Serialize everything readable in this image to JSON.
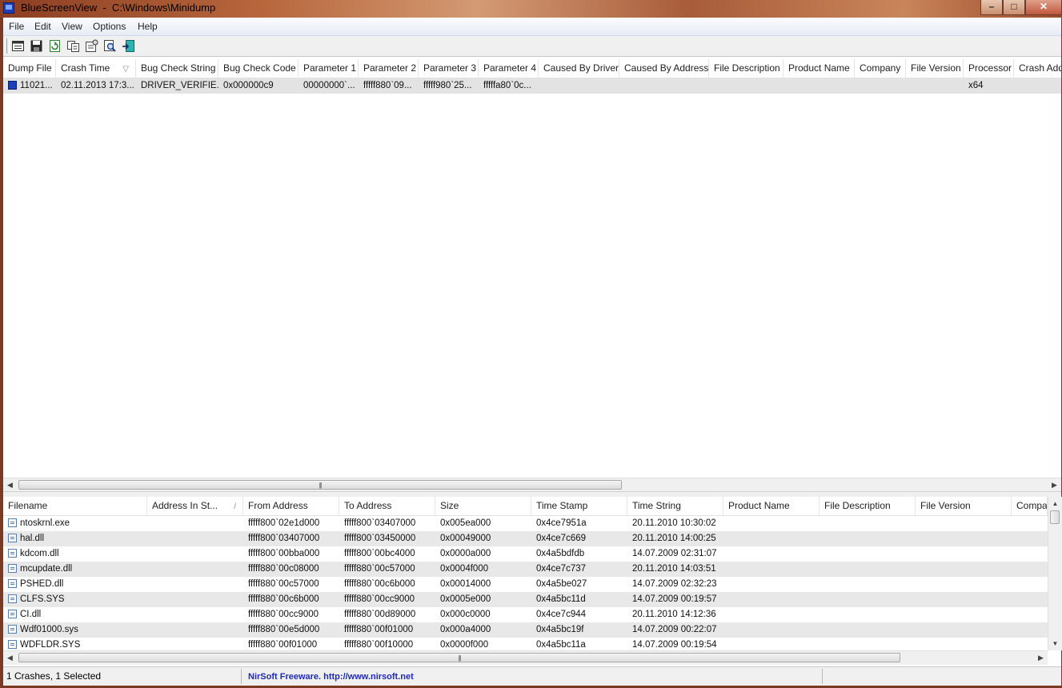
{
  "window": {
    "title": "BlueScreenView  -  C:\\Windows\\Minidump"
  },
  "window_buttons": {
    "minimize": "–",
    "maximize": "□",
    "close": "✕"
  },
  "menu": [
    "File",
    "Edit",
    "View",
    "Options",
    "Help"
  ],
  "toolbar": [
    {
      "name": "properties-icon",
      "label": ""
    },
    {
      "name": "save-icon",
      "label": ""
    },
    {
      "name": "refresh-icon",
      "label": ""
    },
    {
      "name": "copy-icon",
      "label": ""
    },
    {
      "name": "advanced-options-icon",
      "label": ""
    },
    {
      "name": "find-icon",
      "label": ""
    },
    {
      "name": "exit-icon",
      "label": ""
    }
  ],
  "crash_table": {
    "columns": [
      "Dump File",
      "Crash Time",
      "Bug Check String",
      "Bug Check Code",
      "Parameter 1",
      "Parameter 2",
      "Parameter 3",
      "Parameter 4",
      "Caused By Driver",
      "Caused By Address",
      "File Description",
      "Product Name",
      "Company",
      "File Version",
      "Processor",
      "Crash Address"
    ],
    "sort_indicator": "▽",
    "rows": [
      [
        "11021...",
        "02.11.2013 17:3...",
        "DRIVER_VERIFIE...",
        "0x000000c9",
        "00000000`...",
        "fffff880`09...",
        "fffff980`25...",
        "fffffa80`0c...",
        "",
        "",
        "",
        "",
        "",
        "",
        "x64",
        ""
      ]
    ]
  },
  "driver_table": {
    "columns": [
      "Filename",
      "Address In St...",
      "From Address",
      "To Address",
      "Size",
      "Time Stamp",
      "Time String",
      "Product Name",
      "File Description",
      "File Version",
      "Company"
    ],
    "sort_indicator": "/",
    "rows": [
      [
        "ntoskrnl.exe",
        "",
        "fffff800`02e1d000",
        "fffff800`03407000",
        "0x005ea000",
        "0x4ce7951a",
        "20.11.2010 10:30:02",
        "",
        "",
        "",
        ""
      ],
      [
        "hal.dll",
        "",
        "fffff800`03407000",
        "fffff800`03450000",
        "0x00049000",
        "0x4ce7c669",
        "20.11.2010 14:00:25",
        "",
        "",
        "",
        ""
      ],
      [
        "kdcom.dll",
        "",
        "fffff800`00bba000",
        "fffff800`00bc4000",
        "0x0000a000",
        "0x4a5bdfdb",
        "14.07.2009 02:31:07",
        "",
        "",
        "",
        ""
      ],
      [
        "mcupdate.dll",
        "",
        "fffff880`00c08000",
        "fffff880`00c57000",
        "0x0004f000",
        "0x4ce7c737",
        "20.11.2010 14:03:51",
        "",
        "",
        "",
        ""
      ],
      [
        "PSHED.dll",
        "",
        "fffff880`00c57000",
        "fffff880`00c6b000",
        "0x00014000",
        "0x4a5be027",
        "14.07.2009 02:32:23",
        "",
        "",
        "",
        ""
      ],
      [
        "CLFS.SYS",
        "",
        "fffff880`00c6b000",
        "fffff880`00cc9000",
        "0x0005e000",
        "0x4a5bc11d",
        "14.07.2009 00:19:57",
        "",
        "",
        "",
        ""
      ],
      [
        "CI.dll",
        "",
        "fffff880`00cc9000",
        "fffff880`00d89000",
        "0x000c0000",
        "0x4ce7c944",
        "20.11.2010 14:12:36",
        "",
        "",
        "",
        ""
      ],
      [
        "Wdf01000.sys",
        "",
        "fffff880`00e5d000",
        "fffff880`00f01000",
        "0x000a4000",
        "0x4a5bc19f",
        "14.07.2009 00:22:07",
        "",
        "",
        "",
        ""
      ],
      [
        "WDFLDR.SYS",
        "",
        "fffff880`00f01000",
        "fffff880`00f10000",
        "0x0000f000",
        "0x4a5bc11a",
        "14.07.2009 00:19:54",
        "",
        "",
        "",
        ""
      ]
    ]
  },
  "scrollbars": {
    "left_arrow": "◀",
    "right_arrow": "▶",
    "up_arrow": "▲",
    "down_arrow": "▼",
    "grip": "|||"
  },
  "status": {
    "crashes": "1 Crashes, 1 Selected",
    "link": "NirSoft Freeware.  http://www.nirsoft.net"
  }
}
